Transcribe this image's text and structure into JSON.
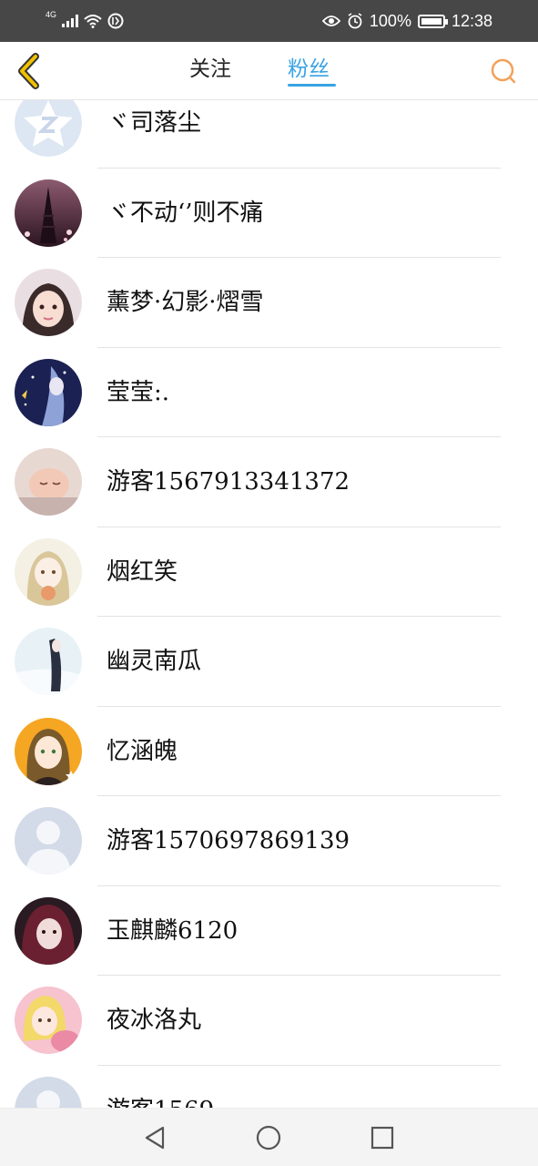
{
  "status_bar": {
    "network": "4G",
    "battery": "100%",
    "battery_level": 1.0,
    "time": "12:38"
  },
  "header": {
    "tabs": [
      {
        "label": "关注",
        "active": false
      },
      {
        "label": "粉丝",
        "active": true
      }
    ],
    "accent_color": "#3aa3e3",
    "back_color": "#f0c000",
    "search_color": "#f2a15a"
  },
  "fans": [
    {
      "name": "ヾ司落尘",
      "avatar": "qq-logo"
    },
    {
      "name": "ヾ不动‘’则不痛",
      "avatar": "eiffel-tower-photo"
    },
    {
      "name": "薰梦·幻影·熠雪",
      "avatar": "girl-photo"
    },
    {
      "name": "莹莹:.",
      "avatar": "anime-night"
    },
    {
      "name": "游客1567913341372",
      "avatar": "sleeping-baby"
    },
    {
      "name": "烟红笑",
      "avatar": "anime-girl-light"
    },
    {
      "name": "幽灵南瓜",
      "avatar": "girl-in-snow"
    },
    {
      "name": "忆涵魄",
      "avatar": "anime-girl-orange"
    },
    {
      "name": "游客1570697869139",
      "avatar": "default-person"
    },
    {
      "name": "玉麒麟6120",
      "avatar": "anime-dark-red"
    },
    {
      "name": "夜冰洛丸",
      "avatar": "anime-blonde-pink"
    },
    {
      "name": "游客1569...",
      "avatar": "default-person"
    }
  ],
  "nav_bar": {
    "buttons": [
      "back",
      "home",
      "recents"
    ]
  }
}
